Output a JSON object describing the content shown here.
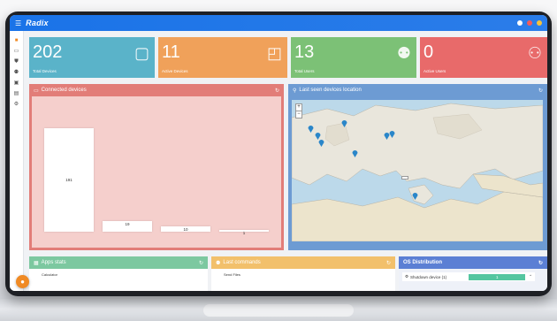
{
  "app": {
    "brand": "Radix"
  },
  "icons": {
    "menu": "menu-icon",
    "help": "help-icon",
    "notifications": "bell-icon",
    "user": "user-icon"
  },
  "tiles": [
    {
      "value": "202",
      "label": "Total Devices",
      "color": "#5ab3c9",
      "icon": "tablet-icon"
    },
    {
      "value": "11",
      "label": "Active Devices",
      "color": "#f0a15a",
      "icon": "cast-icon"
    },
    {
      "value": "13",
      "label": "Total Users",
      "color": "#7cc176",
      "icon": "users-icon"
    },
    {
      "value": "0",
      "label": "Active Users",
      "color": "#e86a6a",
      "icon": "users-outline-icon"
    }
  ],
  "connected": {
    "title": "Connected devices",
    "color": "#e27d78",
    "chart_data": {
      "type": "bar",
      "categories": [
        "",
        "",
        "",
        ""
      ],
      "values": [
        191,
        19,
        10,
        1
      ],
      "ylim": [
        0,
        200
      ]
    }
  },
  "map_panel": {
    "title": "Last seen devices location",
    "color": "#6d9bd3",
    "zoom_in": "+",
    "zoom_out": "−",
    "tooltip": "",
    "attribution": ""
  },
  "apps": {
    "title": "Apps stats",
    "color": "#7cc8a0",
    "first_item": "Calculator"
  },
  "commands": {
    "title": "Last commands",
    "color": "#f2c06b",
    "first_item": "Send Files"
  },
  "os": {
    "title": "OS Distribution",
    "color": "#5b7fd4",
    "row_label": "Shutdown device (1)",
    "row_value": "1",
    "accent": "#54c6a0"
  },
  "fab": {
    "label": ""
  }
}
